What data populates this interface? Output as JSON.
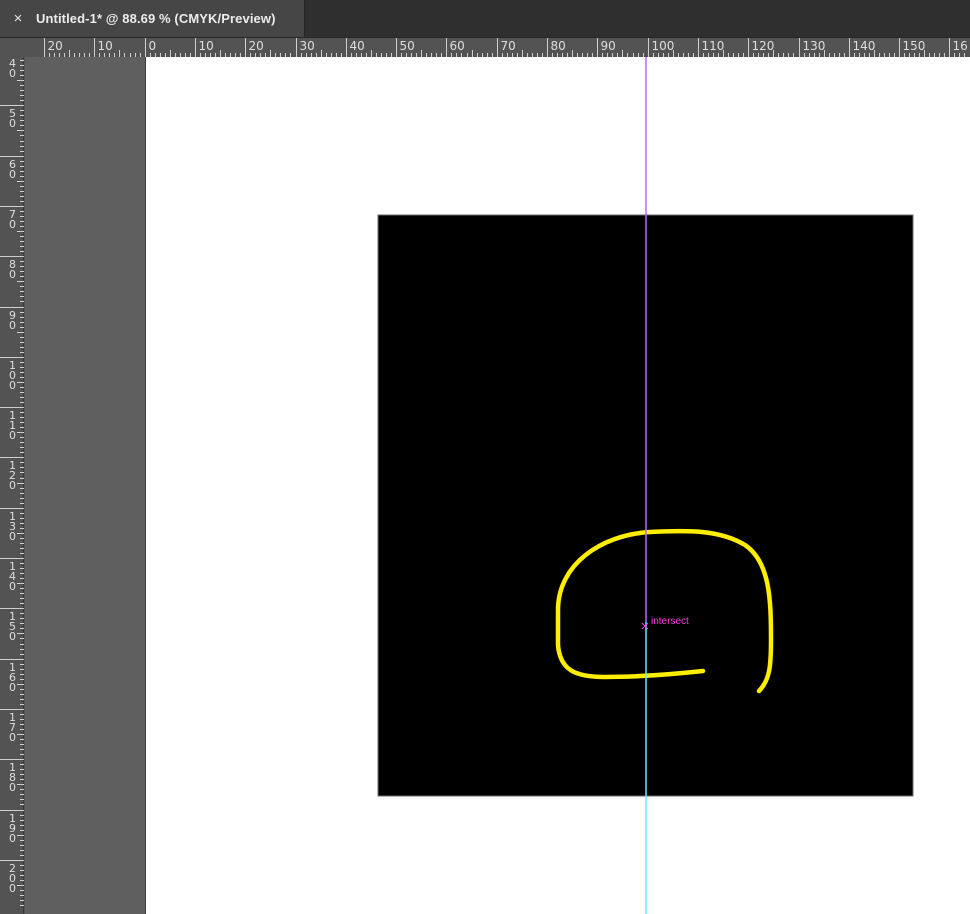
{
  "document_tab": {
    "close_glyph": "×",
    "title": "Untitled-1* @ 88.69 % (CMYK/Preview)"
  },
  "horizontal_ruler": {
    "labels": [
      "20",
      "10",
      "0",
      "10",
      "20",
      "30",
      "40",
      "50",
      "60",
      "70",
      "80",
      "90",
      "100",
      "110",
      "120",
      "130",
      "140",
      "150",
      "16"
    ]
  },
  "vertical_ruler": {
    "labels": [
      "40",
      "50",
      "60",
      "70",
      "80",
      "90",
      "100",
      "110",
      "120",
      "130",
      "140",
      "150",
      "160",
      "170",
      "180",
      "190",
      "200"
    ]
  },
  "canvas": {
    "smart_guide_label": "intersect",
    "colors": {
      "ui_background": "#535353",
      "pasteboard": "#5f5f5f",
      "artboard": "#ffffff",
      "rectangle_fill": "#000000",
      "path_stroke": "#ffee00",
      "guide_purple": "#b36bff",
      "guide_cyan": "#5ff0ff",
      "smart_guide": "#ff3de0"
    }
  }
}
